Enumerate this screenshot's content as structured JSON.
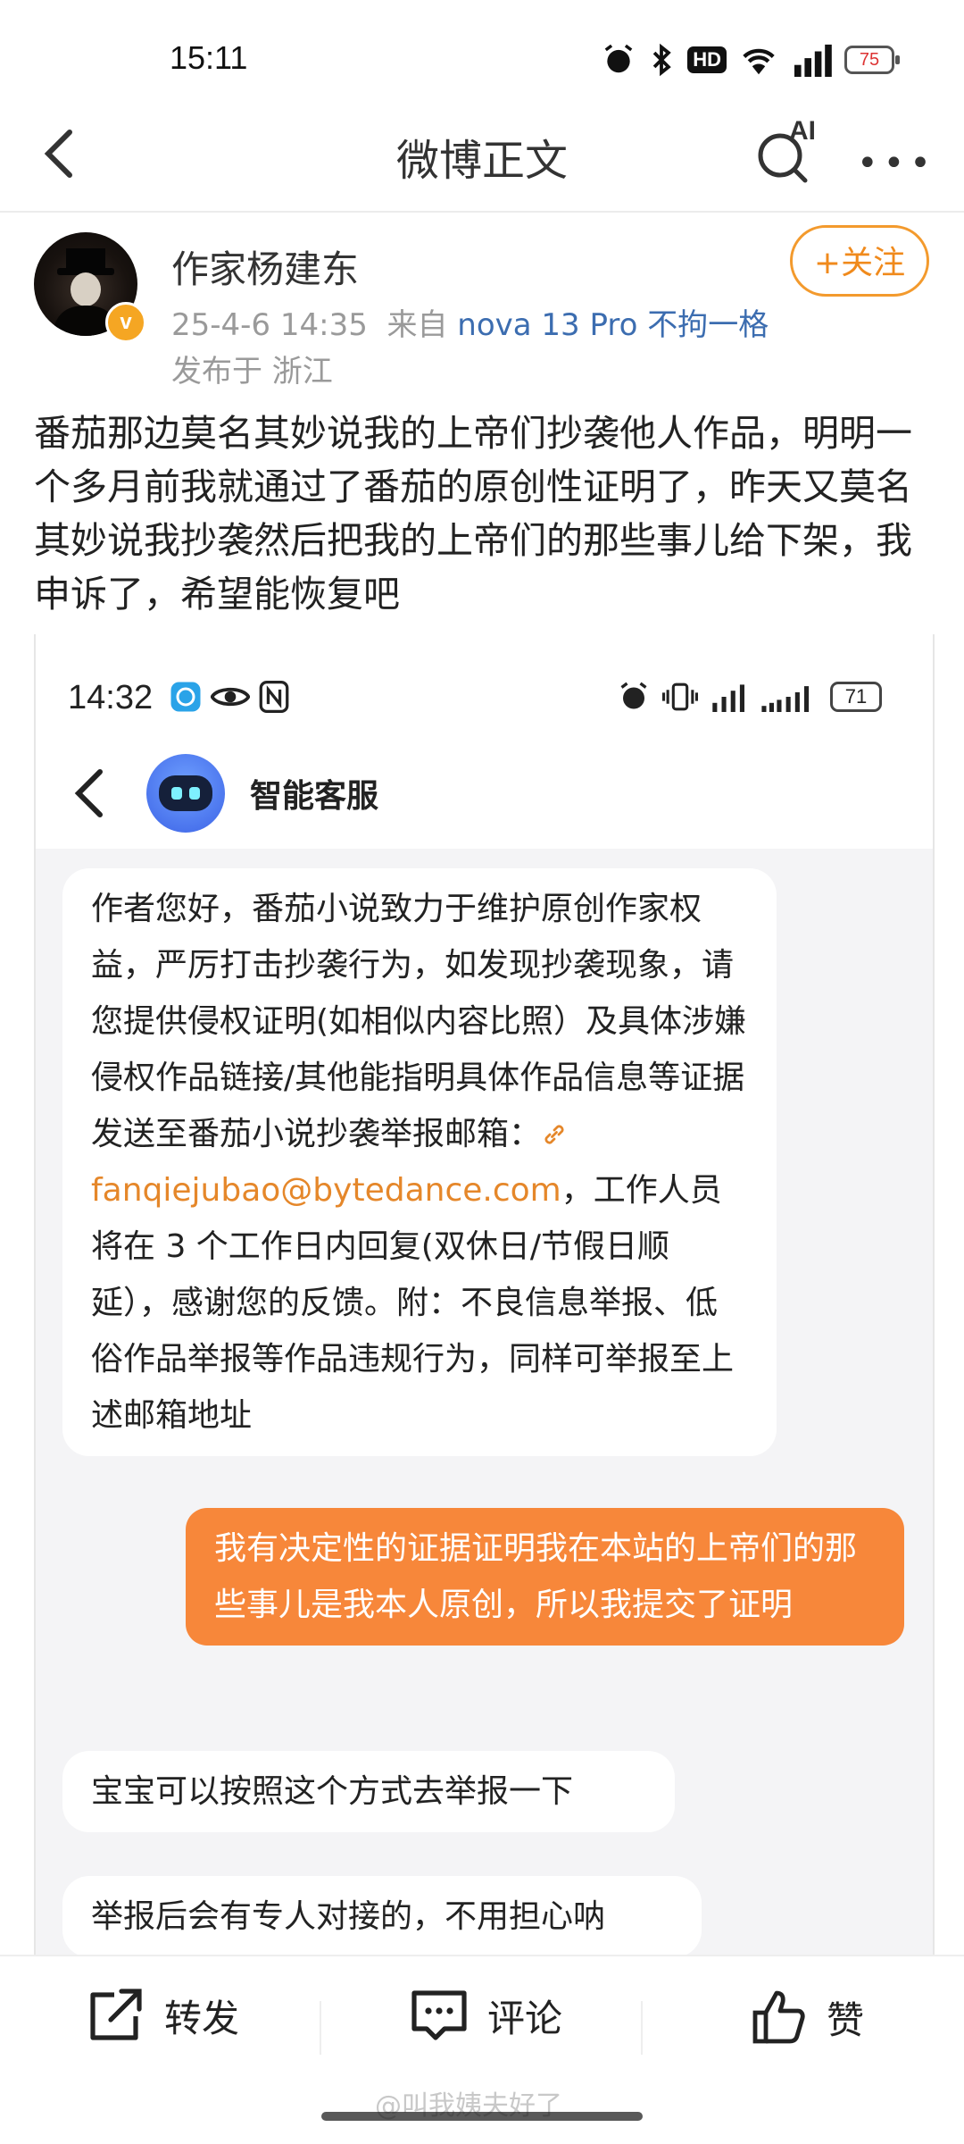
{
  "status_bar": {
    "time": "15:11",
    "hd": "HD",
    "battery": "75"
  },
  "nav": {
    "title": "微博正文",
    "ai_label": "AI"
  },
  "author": {
    "name": "作家杨建东",
    "date": "25-4-6 14:35",
    "from_prefix": "来自",
    "source": "nova 13 Pro 不拘一格",
    "location": "发布于 浙江",
    "follow_label": "+关注",
    "badge": "v"
  },
  "post": {
    "text": "番茄那边莫名其妙说我的上帝们抄袭他人作品，明明一个多月前我就通过了番茄的原创性证明了，昨天又莫名其妙说我抄袭然后把我的上帝们的那些事儿给下架，我申诉了，希望能恢复吧"
  },
  "screenshot": {
    "time": "14:32",
    "battery": "71",
    "chat_title": "智能客服",
    "msg1_before": "作者您好，番茄小说致力于维护原创作家权益，严厉打击抄袭行为，如发现抄袭现象，请您提供侵权证明(如相似内容比照）及具体涉嫌侵权作品链接/其他能指明具体作品信息等证据发送至番茄小说抄袭举报邮箱：",
    "msg1_link": "fanqiejubao@bytedance.com",
    "msg1_after": "，工作人员将在 3 个工作日内回复(双休日/节假日顺延），感谢您的反馈。附：不良信息举报、低俗作品举报等作品违规行为，同样可举报至上述邮箱地址",
    "msg2": "我有决定性的证据证明我在本站的上帝们的那些事儿是我本人原创，所以我提交了证明",
    "msg3": "宝宝可以按照这个方式去举报一下",
    "msg4": "举报后会有专人对接的，不用担心呐"
  },
  "actions": {
    "repost": "转发",
    "comment": "评论",
    "like": "赞"
  },
  "watermark": "@叫我姨夫好了"
}
